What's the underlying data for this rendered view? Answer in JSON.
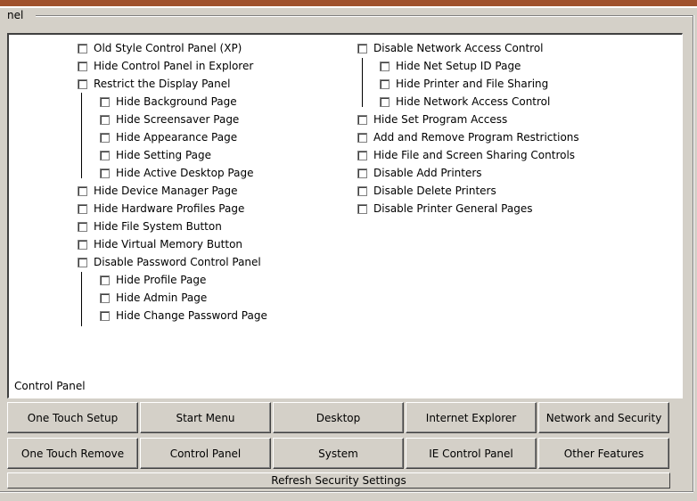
{
  "group": {
    "label": "nel"
  },
  "left_items": [
    {
      "label": "Old Style Control Panel (XP)",
      "checked": false
    },
    {
      "label": "Hide Control Panel in Explorer",
      "checked": false
    },
    {
      "label": "Restrict the Display Panel",
      "checked": false
    },
    {
      "label": "Hide Background Page",
      "checked": false
    },
    {
      "label": "Hide Screensaver Page",
      "checked": false
    },
    {
      "label": "Hide Appearance Page",
      "checked": false
    },
    {
      "label": "Hide Setting Page",
      "checked": false
    },
    {
      "label": "Hide Active Desktop Page",
      "checked": false
    },
    {
      "label": "Hide Device Manager Page",
      "checked": false
    },
    {
      "label": "Hide Hardware Profiles Page",
      "checked": false
    },
    {
      "label": "Hide File System Button",
      "checked": false
    },
    {
      "label": "Hide Virtual Memory Button",
      "checked": false
    },
    {
      "label": "Disable Password Control Panel",
      "checked": false
    },
    {
      "label": "Hide Profile Page",
      "checked": false
    },
    {
      "label": "Hide Admin Page",
      "checked": false
    },
    {
      "label": "Hide Change Password Page",
      "checked": false
    }
  ],
  "right_items": [
    {
      "label": "Disable Network Access Control",
      "checked": false
    },
    {
      "label": "Hide Net Setup ID Page",
      "checked": false
    },
    {
      "label": "Hide Printer and File Sharing",
      "checked": false
    },
    {
      "label": "Hide Network Access Control",
      "checked": false
    },
    {
      "label": "Hide Set Program Access",
      "checked": false
    },
    {
      "label": "Add and Remove Program Restrictions",
      "checked": false
    },
    {
      "label": "Hide File and Screen Sharing Controls",
      "checked": false
    },
    {
      "label": "Disable Add Printers",
      "checked": false
    },
    {
      "label": "Disable Delete Printers",
      "checked": false
    },
    {
      "label": "Disable Printer General Pages",
      "checked": false
    }
  ],
  "section_label": "Control Panel",
  "buttons": {
    "row1": [
      "One Touch Setup",
      "Start Menu",
      "Desktop",
      "Internet Explorer",
      "Network and Security"
    ],
    "row2": [
      "One Touch Remove",
      "Control Panel",
      "System",
      "IE Control Panel",
      "Other Features"
    ]
  },
  "refresh_label": "Refresh Security Settings"
}
